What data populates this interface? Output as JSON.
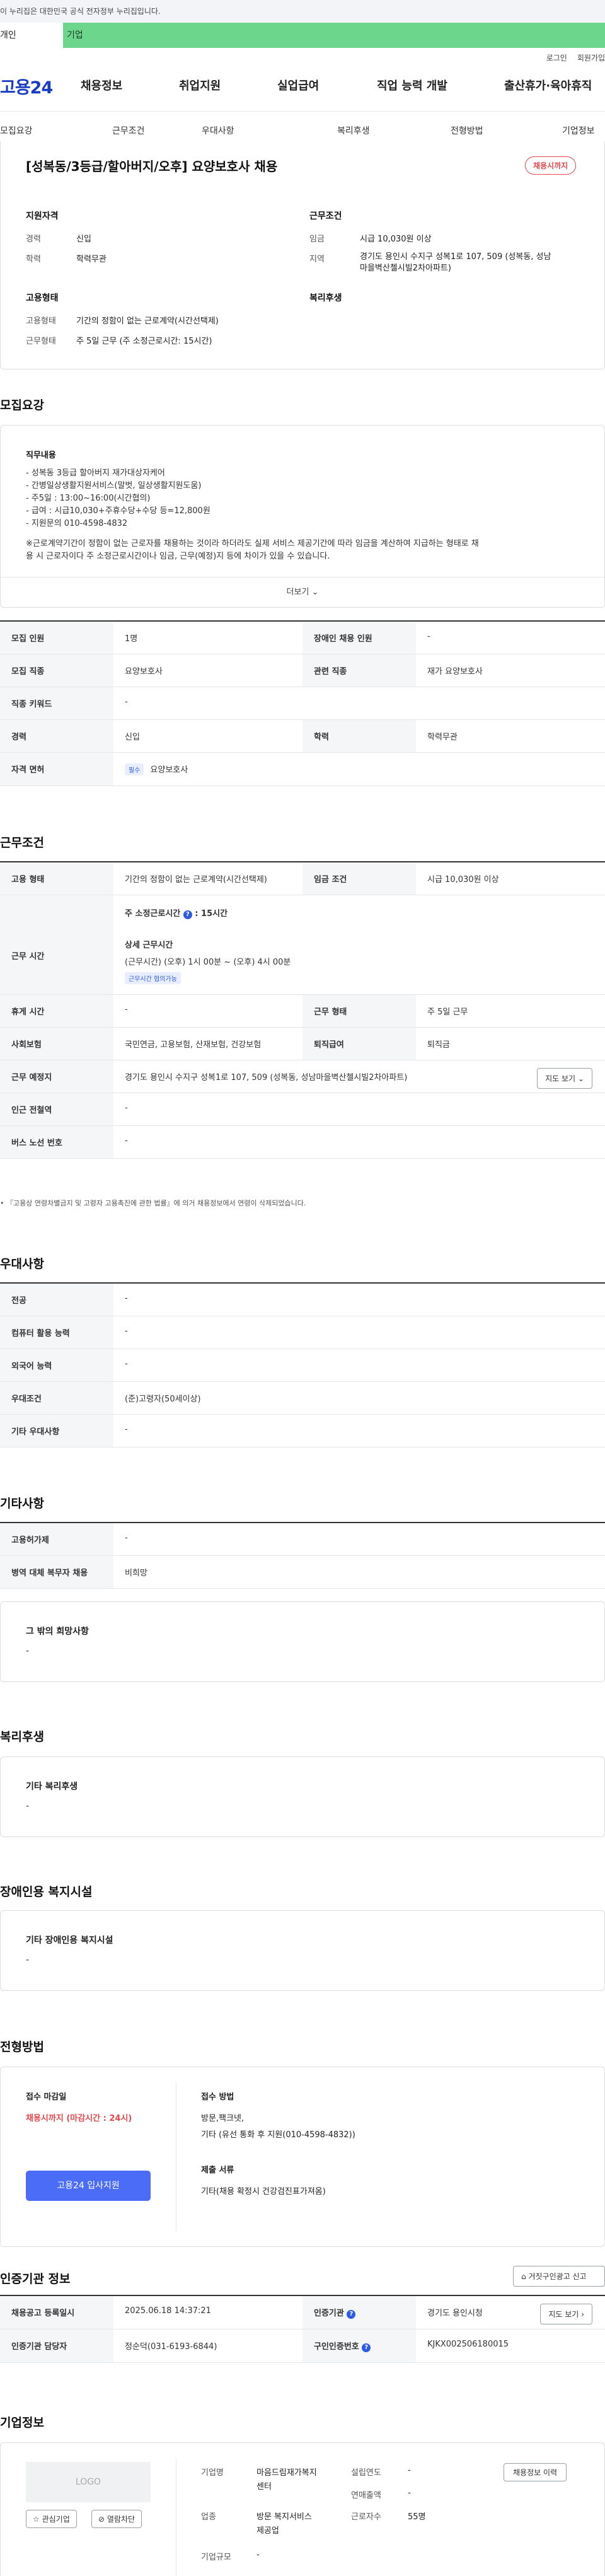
{
  "gov_banner": "이 누리집은 대한민국 공식 전자정부 누리집입니다.",
  "user_tabs": {
    "personal": "개인",
    "company": "기업"
  },
  "util": {
    "login": "로그인",
    "signup": "회원가입"
  },
  "logo": "고용24",
  "gnb": [
    "채용정보",
    "취업지원",
    "실업급여",
    "직업 능력 개발",
    "출산휴가·육아휴직"
  ],
  "subnav": [
    "모집요강",
    "근무조건",
    "우대사항",
    "복리후생",
    "전형방법",
    "기업정보"
  ],
  "summary": {
    "title": "[성복동/3등급/할아버지/오후] 요양보호사 채용",
    "badge": "채용시까지",
    "qual_head": "지원자격",
    "cond_head": "근무조건",
    "career_lbl": "경력",
    "career": "신입",
    "edu_lbl": "학력",
    "edu": "학력무관",
    "wage_lbl": "임금",
    "wage": "시급 10,030원 이상",
    "region_lbl": "지역",
    "region1": "경기도 용인시 수지구 성복1로 107, 509 (성복동, 성남",
    "region2": "마을벽산첼시빌2차아파트)",
    "emp_head": "고용형태",
    "welfare_head": "복리후생",
    "emptype_lbl": "고용형태",
    "emptype": "기간의 정함이 없는 근로계약(시간선택제)",
    "worktype_lbl": "근무형태",
    "worktype": "주 5일 근무 (주 소정근로시간: 15시간)"
  },
  "recruit": {
    "heading": "모집요강",
    "duty_head": "직무내용",
    "lines": [
      "- 성복동 3등급 할아버지 재가대상자케어",
      "- 간병일상생활지원서비스(말벗, 일상생활지원도움)",
      "- 주5일 : 13:00~16:00(시간협의)",
      "- 급여 : 시급10,030+주휴수당+수당 등=12,800원",
      "- 지원문의 010-4598-4832"
    ],
    "note1": "※근로계약기간이 정함이 없는 근로자를 채용하는 것이라 하더라도 실제 서비스 제공기간에 따라 임금을 계산하여 지급하는 형태로 채",
    "note2": "용 시 근로자이다 주 소정근로시간이나 임금, 근무(예정)지 등에 차이가 있을 수 있습니다.",
    "more": "더보기",
    "rows": [
      {
        "l1": "모집 인원",
        "v1": "1명",
        "l2": "장애인 채용 인원",
        "v2": "-"
      },
      {
        "l1": "모집 직종",
        "v1": "요양보호사",
        "l2": "관련 직종",
        "v2": "재가 요양보호사"
      },
      {
        "l1": "직종 키워드",
        "v1": "-"
      },
      {
        "l1": "경력",
        "v1": "신입",
        "l2": "학력",
        "v2": "학력무관"
      },
      {
        "l1": "자격 면허",
        "chip": "필수",
        "v1": "요양보호사"
      }
    ]
  },
  "conditions": {
    "heading": "근무조건",
    "emptype_lbl": "고용 형태",
    "emptype": "기간의 정함이 없는 근로계약(시간선택제)",
    "wage_lbl": "임금 조건",
    "wage": "시급 10,030원 이상",
    "hours_lbl": "근무 시간",
    "weekly": "주 소정근로시간",
    "weekly_val": "15시간",
    "detail_head": "상세 근무시간",
    "detail_val": "(근무시간) (오후) 1시 00분 ~ (오후) 4시 00분",
    "detail_chip": "근무시간 협의가능",
    "rest_lbl": "휴게 시간",
    "rest": "-",
    "form_lbl": "근무 형태",
    "form": "주 5일 근무",
    "ins_lbl": "사회보험",
    "ins": "국민연금, 고용보험, 산재보험, 건강보험",
    "sev_lbl": "퇴직급여",
    "sev": "퇴직금",
    "place_lbl": "근무 예정지",
    "place": "경기도 용인시 수지구 성복1로 107, 509 (성복동, 성남마을벽산첼시빌2차아파트)",
    "map_btn": "지도 보기",
    "subway_lbl": "인근 전철역",
    "subway": "-",
    "bus_lbl": "버스 노선 번호",
    "bus": "-",
    "note": "• 『고용상 연령차별금지 및 고령자 고용촉진에 관한 법률』에 의거 채용정보에서 연령이 삭제되었습니다."
  },
  "prefer": {
    "heading": "우대사항",
    "rows": [
      {
        "l": "전공",
        "v": "-"
      },
      {
        "l": "컴퓨터 활용 능력",
        "v": "-"
      },
      {
        "l": "외국어 능력",
        "v": "-"
      },
      {
        "l": "우대조건",
        "v": "(준)고령자(50세이상)"
      },
      {
        "l": "기타 우대사항",
        "v": "-"
      }
    ]
  },
  "other": {
    "heading": "기타사항",
    "rows": [
      {
        "l": "고용허가제",
        "v": "-"
      },
      {
        "l": "병역 대체 복무자 채용",
        "v": "비희망"
      }
    ],
    "box_title": "그 밖의 희망사항",
    "box_val": "-"
  },
  "welfare": {
    "heading": "복리후생",
    "box_title": "기타 복리후생",
    "box_val": "-"
  },
  "disability": {
    "heading": "장애인용 복지시설",
    "box_title": "기타 장애인용 복지시설",
    "box_val": "-"
  },
  "process": {
    "heading": "전형방법",
    "deadline_lbl": "접수 마감일",
    "deadline": "채용시까지 (마감시간 : 24시)",
    "apply_btn": "고용24 입사지원",
    "method_lbl": "접수 방법",
    "method1": "방문,팩크넷,",
    "method2": "기타 (유선 통화 후 지원(010-4598-4832))",
    "docs_lbl": "제출 서류",
    "docs": "기타(채용 확정시 건강검진표가져옴)"
  },
  "agency": {
    "heading": "인증기관 정보",
    "report_btn": "거짓구인광고 신고",
    "reg_lbl": "채용공고 등록일시",
    "reg": "2025.06.18 14:37:21",
    "org_lbl": "인증기관",
    "org": "경기도 용인시청",
    "map_btn": "지도 보기",
    "mgr_lbl": "인증기관 담당자",
    "mgr": "정순덕(031-6193-6844)",
    "cert_lbl": "구인인증번호",
    "cert": "KJKX002506180015"
  },
  "company": {
    "heading": "기업정보",
    "logo": "LOGO",
    "fav_btn": "관심기업",
    "block_btn": "열람차단",
    "name_lbl": "기업명",
    "name1": "마음드림재가복지",
    "name2": "센터",
    "ind_lbl": "업종",
    "ind1": "방문 복지서비스",
    "ind2": "제공업",
    "scale_lbl": "기업규모",
    "scale": "-",
    "est_lbl": "설립연도",
    "est": "-",
    "sales_lbl": "연매출액",
    "sales": "-",
    "emp_lbl": "근로자수",
    "emp": "55명",
    "hist_btn": "채용정보 이력"
  },
  "colors": {
    "brand": "#1a3cc2",
    "accent": "#e5484d",
    "company_tab": "#6dd68d",
    "button": "#4a6cf7"
  }
}
